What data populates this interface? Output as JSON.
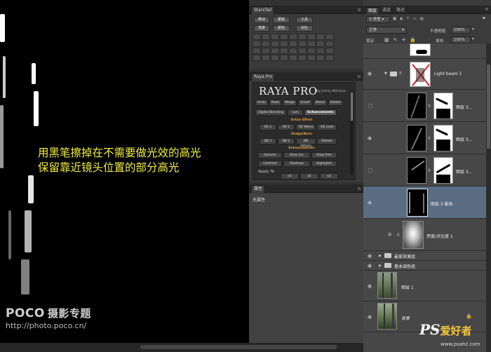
{
  "canvas": {
    "overlay_line1": "用黑笔擦掉在不需要做光效的高光",
    "overlay_line2": "保留靠近镜头位置的部分高光",
    "overlay_color": "#f4ee3c",
    "watermark_brand": "POCO",
    "watermark_sub": "摄影专题",
    "watermark_url": "http://photo.poco.cn/"
  },
  "stars_panel": {
    "tab": "StarsTail",
    "row1": [
      "移动",
      "蒙版",
      "工具"
    ],
    "row2": [
      "亮度",
      "颜色",
      "对比"
    ],
    "grid_rows": [
      [
        "",
        "",
        "",
        "",
        "",
        "",
        "",
        "",
        ""
      ],
      [
        "",
        "",
        "",
        "",
        "",
        "",
        "",
        "",
        ""
      ],
      [
        "",
        "",
        "",
        "",
        "",
        "",
        "",
        "",
        ""
      ],
      [
        "",
        "",
        "",
        "",
        "",
        "",
        "",
        "",
        ""
      ]
    ]
  },
  "raya_panel": {
    "tab": "Raya Pro",
    "title": "RAYA PRO",
    "byline": "By Jimmy McIntyre",
    "top_buttons": [
      "Undo",
      "Redo",
      "Merge",
      "Smart",
      "Detail",
      "Delete"
    ],
    "tabs": [
      "Digital Blending",
      "Lum",
      "Enhancements"
    ],
    "section_orton": "Orton Effect",
    "orton_buttons": [
      "OE 1",
      "OE 2",
      "OE Warm",
      "OE Cold"
    ],
    "section_dodge": "Dodge/Burn",
    "dodge_buttons": [
      "DB 1",
      "DB 2",
      "DB Details",
      "Details"
    ],
    "section_enh": "Enhancements",
    "enh_row1": [
      "Autumn",
      "Glow Cur",
      "Glow Free"
    ],
    "enh_row2": [
      "Contrast",
      "Shadows",
      "Highlights"
    ],
    "apply_label": "Apply To",
    "apply_buttons": [
      "x1",
      "x2",
      "x3"
    ]
  },
  "properties_panel": {
    "tab": "属性",
    "none_text": "无属性"
  },
  "layers_panel": {
    "tabs": [
      "图层",
      "通道",
      "路径"
    ],
    "filter_kind": "类型",
    "blend_mode": "正常",
    "opacity_label": "不透明度:",
    "opacity_value": "100%",
    "lock_label": "锁定:",
    "fill_label": "填充:",
    "fill_value": "100%",
    "layers": [
      {
        "name": "",
        "type": "mask-top"
      },
      {
        "name": "Light beam 1",
        "type": "group"
      },
      {
        "name": "图层 3...",
        "type": "layer-mask"
      },
      {
        "name": "图层 3...",
        "type": "layer-mask"
      },
      {
        "name": "图层 3...",
        "type": "layer-mask"
      },
      {
        "name": "图层 3 副本",
        "type": "selected"
      },
      {
        "name": "亮度/对比度 1",
        "type": "adjustment"
      },
      {
        "name": "最爱效果组",
        "type": "folder"
      },
      {
        "name": "基本调色组",
        "type": "folder"
      },
      {
        "name": "图层 1",
        "type": "photo"
      },
      {
        "name": "背景",
        "type": "background"
      }
    ]
  },
  "brand_logo": {
    "ps": "PS",
    "cn": "爱好者",
    "url": "www.psahz.com"
  }
}
